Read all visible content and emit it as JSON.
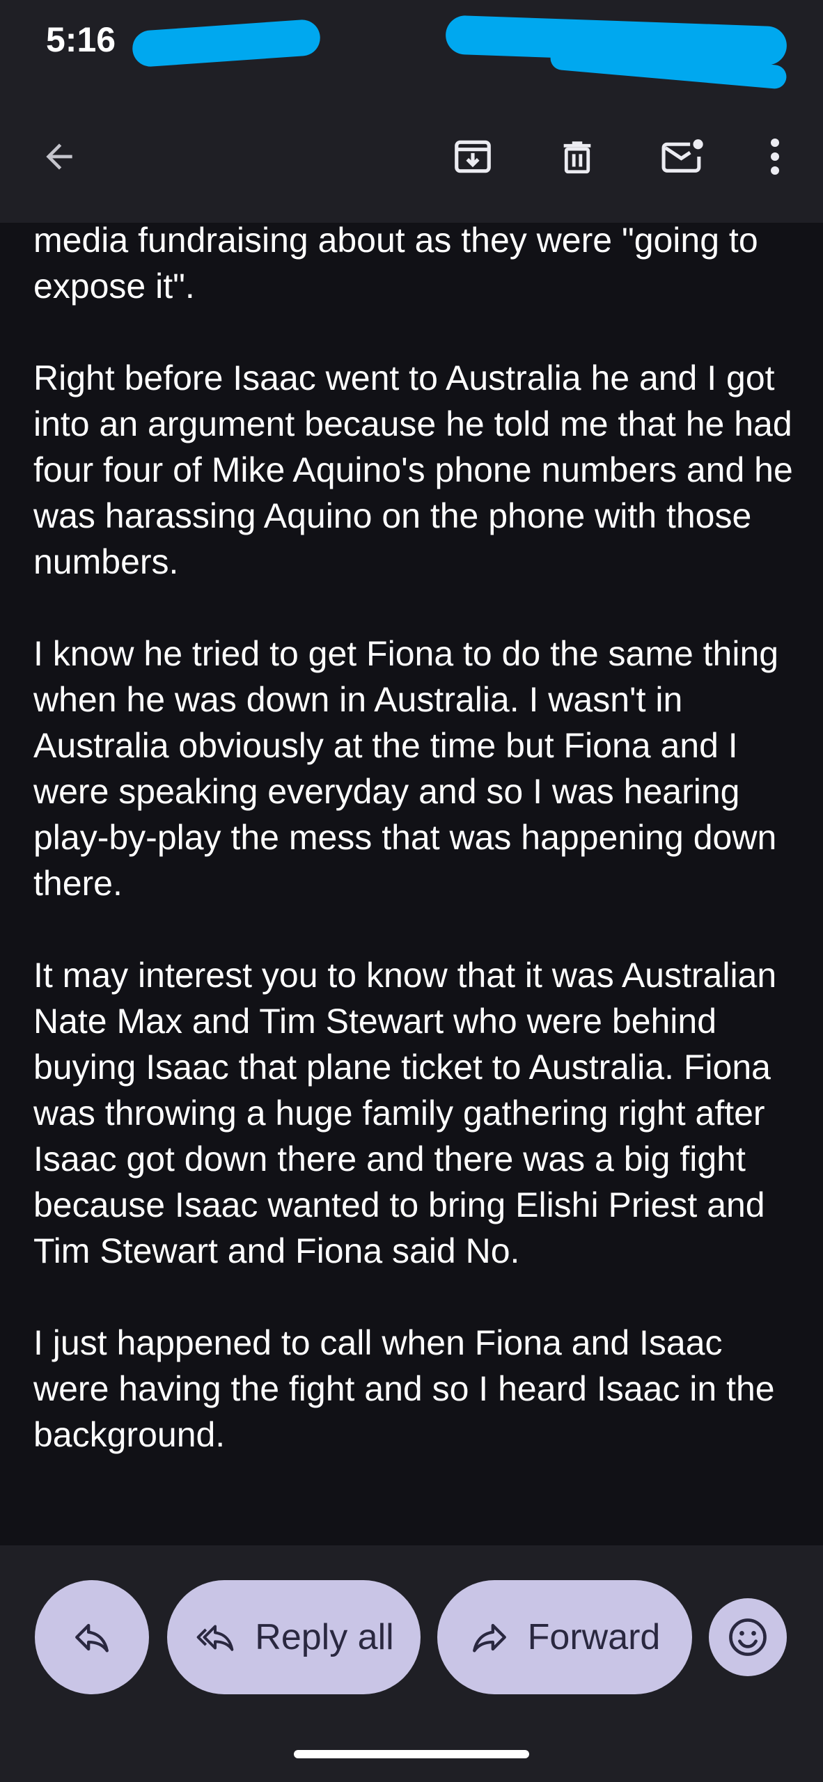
{
  "status_bar": {
    "time": "5:16"
  },
  "app_bar": {
    "back_icon": "arrow-back-icon",
    "archive_icon": "archive-icon",
    "delete_icon": "trash-icon",
    "mark_unread_icon": "mail-unread-icon",
    "more_icon": "more-vert-icon"
  },
  "message": {
    "cut_line": "",
    "paragraphs": [
      "media fundraising about as they were \"going to expose it\".",
      "Right before Isaac went to Australia he and I got into an argument because he told me that he had four four of Mike Aquino's phone numbers and he was harassing Aquino on the phone with those numbers.",
      "I know he tried to get Fiona to do the same thing when he was down in Australia. I wasn't in Australia obviously at the time but Fiona and I were speaking everyday and so I was hearing play-by-play the mess that was happening down there.",
      "It may interest you to know that it was Australian Nate Max and Tim Stewart who were behind buying Isaac that plane ticket to Australia. Fiona was throwing a huge family gathering right after Isaac got down there and there was a big fight because Isaac wanted to bring Elishi Priest and Tim Stewart and Fiona said No.",
      "I just happened to call when Fiona and Isaac were having the fight and so I heard Isaac in the background."
    ]
  },
  "actions": {
    "reply_icon": "reply-icon",
    "reply_all_label": "Reply all",
    "reply_all_icon": "reply-all-icon",
    "forward_label": "Forward",
    "forward_icon": "forward-icon",
    "emoji_icon": "emoji-icon"
  },
  "colors": {
    "background": "#1f1f25",
    "body_background": "#111116",
    "pill": "#c9c5e6",
    "pill_text": "#2a2840",
    "redaction": "#00a8ef"
  }
}
